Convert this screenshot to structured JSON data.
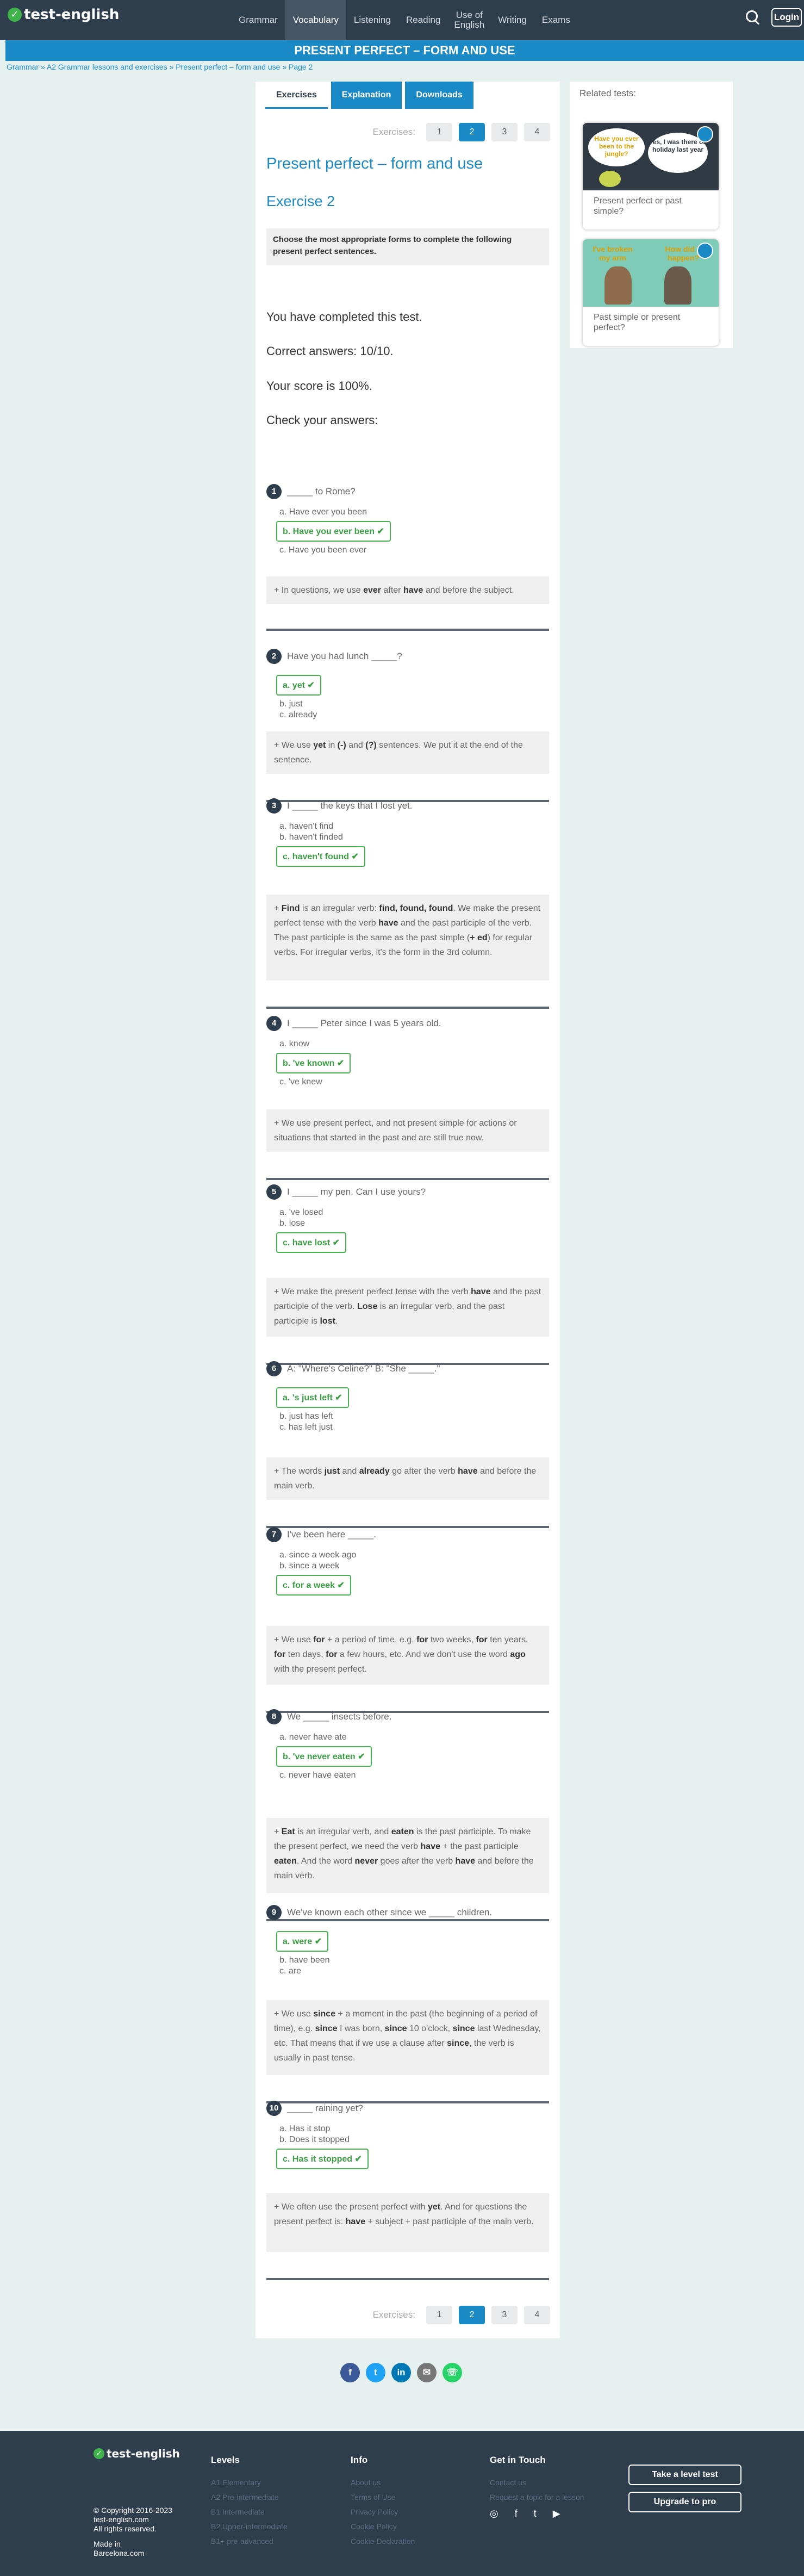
{
  "nav": {
    "logo": "test-english",
    "items": [
      "Grammar",
      "Vocabulary",
      "Listening",
      "Reading",
      "Use of English",
      "Writing",
      "Exams"
    ],
    "login": "Login"
  },
  "title": "PRESENT PERFECT – FORM AND USE",
  "breadcrumb": "Grammar » A2 Grammar lessons and exercises » Present perfect – form and use » Page 2",
  "tabs": [
    "Exercises",
    "Explanation",
    "Downloads"
  ],
  "pager": {
    "label": "Exercises:",
    "pages": [
      "1",
      "2",
      "3",
      "4"
    ],
    "current": "2"
  },
  "heading": "Present perfect – form and use",
  "exercise": "Exercise 2",
  "instruction": "Choose the most appropriate forms to complete the following present perfect sentences.",
  "result": {
    "completed": "You have completed this test.",
    "correct": "Correct answers: 10/10.",
    "score": "Your score is 100%.",
    "check": "Check your answers:"
  },
  "questions": [
    {
      "n": "1",
      "text": "_____ to Rome?",
      "options": [
        {
          "t": "a. Have ever you been",
          "ok": false
        },
        {
          "t": "b. Have you ever been ✔",
          "ok": true
        },
        {
          "t": "c. Have you been ever",
          "ok": false
        }
      ],
      "expl": "<span>+</span> In questions, we use <b>ever</b> after <b>have</b> and before the subject."
    },
    {
      "n": "2",
      "text": "Have you had lunch _____?",
      "options": [
        {
          "t": "a. yet ✔",
          "ok": true
        },
        {
          "t": "b. just",
          "ok": false
        },
        {
          "t": "c. already",
          "ok": false
        }
      ],
      "expl": "<span>+</span> We use <b>yet</b> in <b>(-)</b> and <b>(?)</b> sentences. We put it at the end of the sentence."
    },
    {
      "n": "3",
      "text": "I _____ the keys that I lost yet.",
      "options": [
        {
          "t": "a. haven't find",
          "ok": false
        },
        {
          "t": "b. haven't finded",
          "ok": false
        },
        {
          "t": "c. haven't found ✔",
          "ok": true
        }
      ],
      "expl": "<span>+</span> <b>Find</b> is an irregular verb: <b>find, found, found</b>. We make the present perfect tense with the verb <b>have</b> and the past participle of the verb. The past participle is the same as the past simple (<b>+ ed</b>) for regular verbs. For irregular verbs, it's the form in the 3rd column."
    },
    {
      "n": "4",
      "text": "I _____ Peter since I was 5 years old.",
      "options": [
        {
          "t": "a. know",
          "ok": false
        },
        {
          "t": "b. 've known ✔",
          "ok": true
        },
        {
          "t": "c. 've knew",
          "ok": false
        }
      ],
      "expl": "<span>+</span> We use present perfect, and not present simple for actions or situations that started in the past and are still true now."
    },
    {
      "n": "5",
      "text": "I _____ my pen. Can I use yours?",
      "options": [
        {
          "t": "a. 've losed",
          "ok": false
        },
        {
          "t": "b. lose",
          "ok": false
        },
        {
          "t": "c. have lost ✔",
          "ok": true
        }
      ],
      "expl": "<span>+</span> We make the present perfect tense with the verb <b>have</b> and the past participle of the verb. <b>Lose</b> is an irregular verb, and the past participle is <b>lost</b>."
    },
    {
      "n": "6",
      "text": "A: \"Where's Celine?\" B: \"She _____.\"",
      "options": [
        {
          "t": "a. 's just left ✔",
          "ok": true
        },
        {
          "t": "b. just has left",
          "ok": false
        },
        {
          "t": "c. has left just",
          "ok": false
        }
      ],
      "expl": "<span>+</span> The words <b>just</b> and <b>already</b> go after the verb <b>have</b> and before the main verb."
    },
    {
      "n": "7",
      "text": "I've been here _____.",
      "options": [
        {
          "t": "a. since a week ago",
          "ok": false
        },
        {
          "t": "b. since a week",
          "ok": false
        },
        {
          "t": "c. for a week ✔",
          "ok": true
        }
      ],
      "expl": "<span>+</span> We use <b>for</b> + a period of time, e.g. <b>for</b> two weeks, <b>for</b> ten years, <b>for</b> ten days, <b>for</b> a few hours, etc. And we don't use the word <b>ago</b> with the present perfect."
    },
    {
      "n": "8",
      "text": "We _____ insects before.",
      "options": [
        {
          "t": "a. never have ate",
          "ok": false
        },
        {
          "t": "b. 've never eaten ✔",
          "ok": true
        },
        {
          "t": "c. never have eaten",
          "ok": false
        }
      ],
      "expl": "<span>+</span> <b>Eat</b> is an irregular verb, and <b>eaten</b> is the past participle. To make the present perfect, we need the verb <b>have</b> + the past participle <b>eaten</b>. And the word <b>never</b> goes after the verb <b>have</b> and before the main verb."
    },
    {
      "n": "9",
      "text": "We've known each other since we _____ children.",
      "options": [
        {
          "t": "a. were ✔",
          "ok": true
        },
        {
          "t": "b. have been",
          "ok": false
        },
        {
          "t": "c. are",
          "ok": false
        }
      ],
      "expl": "<span>+</span> We use <b>since</b> + a moment in the past (the beginning of a period of time), e.g. <b>since</b> I was born, <b>since</b> 10 o'clock, <b>since</b> last Wednesday, etc. That means that if we use a clause after <b>since</b>, the verb is usually in past tense."
    },
    {
      "n": "10",
      "text": "_____ raining yet?",
      "options": [
        {
          "t": "a. Has it stop",
          "ok": false
        },
        {
          "t": "b. Does it stopped",
          "ok": false
        },
        {
          "t": "c. Has it stopped ✔",
          "ok": true
        }
      ],
      "expl": "<span>+</span> We often use the present perfect with <b>yet</b>. And for questions the present perfect is: <b>have</b> + subject + past participle of the main verb."
    }
  ],
  "sidebar": {
    "title": "Related tests:",
    "cards": [
      {
        "caption": "Present perfect or past simple?",
        "bubble1": "Have you ever been to the jungle?",
        "bubble2": "Yes, I was there on holiday last year"
      },
      {
        "caption": "Past simple or present perfect?",
        "bubble1": "I've broken my arm",
        "bubble2": "How did it happen?"
      }
    ]
  },
  "footer": {
    "logo": "test-english",
    "copyright": "© Copyright 2016-2023",
    "site": "test-english.com",
    "rights": "All rights reserved.",
    "madein": "Made in",
    "city": "Barcelona.com",
    "levels": {
      "title": "Levels",
      "items": [
        "A1 Elementary",
        "A2 Pre-intermediate",
        "B1 Intermediate",
        "B2 Upper-intermediate",
        "B1+ pre-advanced"
      ]
    },
    "info": {
      "title": "Info",
      "items": [
        "About us",
        "Terms of Use",
        "Privacy Policy",
        "Cookie Policy",
        "Cookie Declaration"
      ]
    },
    "touch": {
      "title": "Get in Touch",
      "items": [
        "Contact us",
        "Request a topic for a lesson"
      ]
    },
    "buttons": [
      "Take a level test",
      "Upgrade to pro"
    ]
  },
  "colors": {
    "accent": "#1a8ac7",
    "nav": "#2f3e4d",
    "correct": "#45b44e"
  }
}
